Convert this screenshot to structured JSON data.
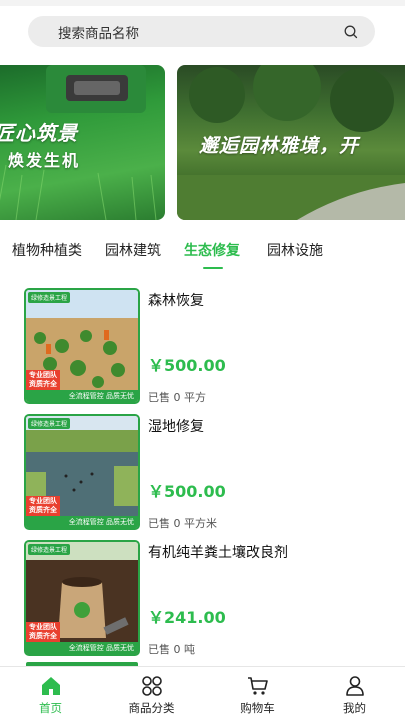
{
  "search": {
    "placeholder": "搜索商品名称",
    "icon": "search-icon"
  },
  "banners": [
    {
      "line1": "匠心筑景",
      "line2": "焕发生机"
    },
    {
      "line1": "邂逅园林雅境，开"
    }
  ],
  "categories": [
    {
      "label": "植物种植类",
      "active": false
    },
    {
      "label": "园林建筑",
      "active": false
    },
    {
      "label": "生态修复",
      "active": true
    },
    {
      "label": "园林设施",
      "active": false
    }
  ],
  "products": [
    {
      "name": "森林恢复",
      "price": "￥500.00",
      "sold": "已售 0 平方",
      "badge_top": "绿修造景工程",
      "badge_red": "专业团队\n资质齐全",
      "badge_bottom": "全流程管控  品质无忧"
    },
    {
      "name": "湿地修复",
      "price": "￥500.00",
      "sold": "已售 0 平方米",
      "badge_top": "绿修造景工程",
      "badge_red": "专业团队\n资质齐全",
      "badge_bottom": "全流程管控  品质无忧"
    },
    {
      "name": "有机纯羊粪土壤改良剂",
      "price": "￥241.00",
      "sold": "已售 0 吨",
      "badge_top": "绿修造景工程",
      "badge_red": "专业团队\n资质齐全",
      "badge_bottom": "全流程管控  品质无忧"
    }
  ],
  "tabbar": [
    {
      "label": "首页",
      "icon": "home-icon",
      "active": true
    },
    {
      "label": "商品分类",
      "icon": "category-grid-icon",
      "active": false
    },
    {
      "label": "购物车",
      "icon": "cart-icon",
      "active": false
    },
    {
      "label": "我的",
      "icon": "user-icon",
      "active": false
    }
  ],
  "colors": {
    "accent": "#2dbc4e",
    "badge_green": "#2aa446",
    "badge_red": "#e9402f"
  }
}
